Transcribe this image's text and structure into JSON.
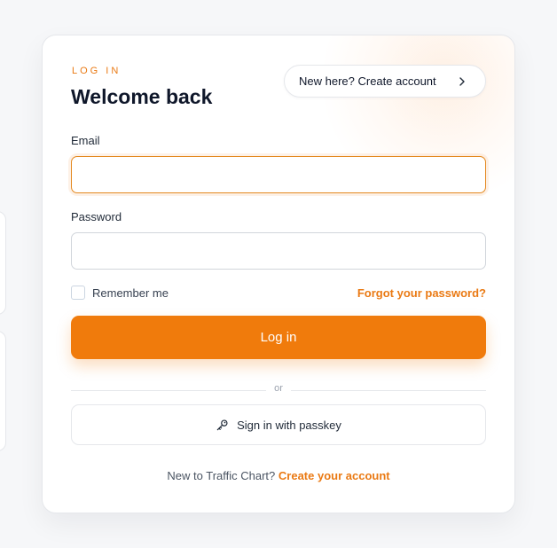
{
  "login": {
    "eyebrow": "LOG IN",
    "title": "Welcome back",
    "create_pill_label": "New here? Create account",
    "email_label": "Email",
    "email_value": "",
    "password_label": "Password",
    "password_value": "",
    "remember_label": "Remember me",
    "forgot_label": "Forgot your password?",
    "login_button": "Log in",
    "divider_text": "or",
    "passkey_button": "Sign in with passkey",
    "footer_text": "New to Traffic Chart?",
    "footer_link": "Create your account"
  },
  "colors": {
    "accent": "#f07b0c",
    "accent_text": "#ea7a14",
    "background": "#f6f7f9",
    "text": "#0f172a"
  },
  "icons": {
    "pill_icon": "chevron-right-icon",
    "passkey_icon": "key-icon"
  }
}
